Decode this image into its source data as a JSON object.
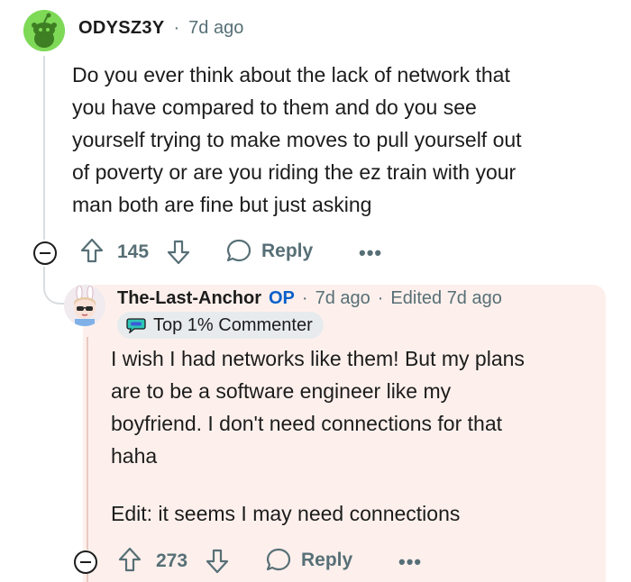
{
  "comment": {
    "username": "ODYSZ3Y",
    "separator": "·",
    "time": "7d ago",
    "body_lines": [
      "Do you ever think about the lack of network that",
      "you have compared to them and do you see",
      "yourself trying to make moves to pull yourself out",
      "of poverty or are you riding the ez train with your",
      "man both are fine but just asking"
    ],
    "upvotes": "145",
    "reply_label": "Reply",
    "more_label": "•••"
  },
  "reply": {
    "username": "The-Last-Anchor",
    "op_label": "OP",
    "separator": "·",
    "time": "7d ago",
    "edited": "Edited 7d ago",
    "flair": "Top 1% Commenter",
    "body_lines": [
      "I wish I had networks like them! But my plans",
      "are to be a software engineer like my",
      "boyfriend. I don't need connections for that",
      "haha"
    ],
    "edit_line": "Edit: it seems I may need connections",
    "upvotes": "273",
    "reply_label": "Reply",
    "more_label": "•••"
  },
  "colors": {
    "highlight_bg": "#fdf0ec",
    "op_blue": "#0a60c9",
    "meta_gray": "#576f76",
    "snoo_green": "#7ed957"
  }
}
